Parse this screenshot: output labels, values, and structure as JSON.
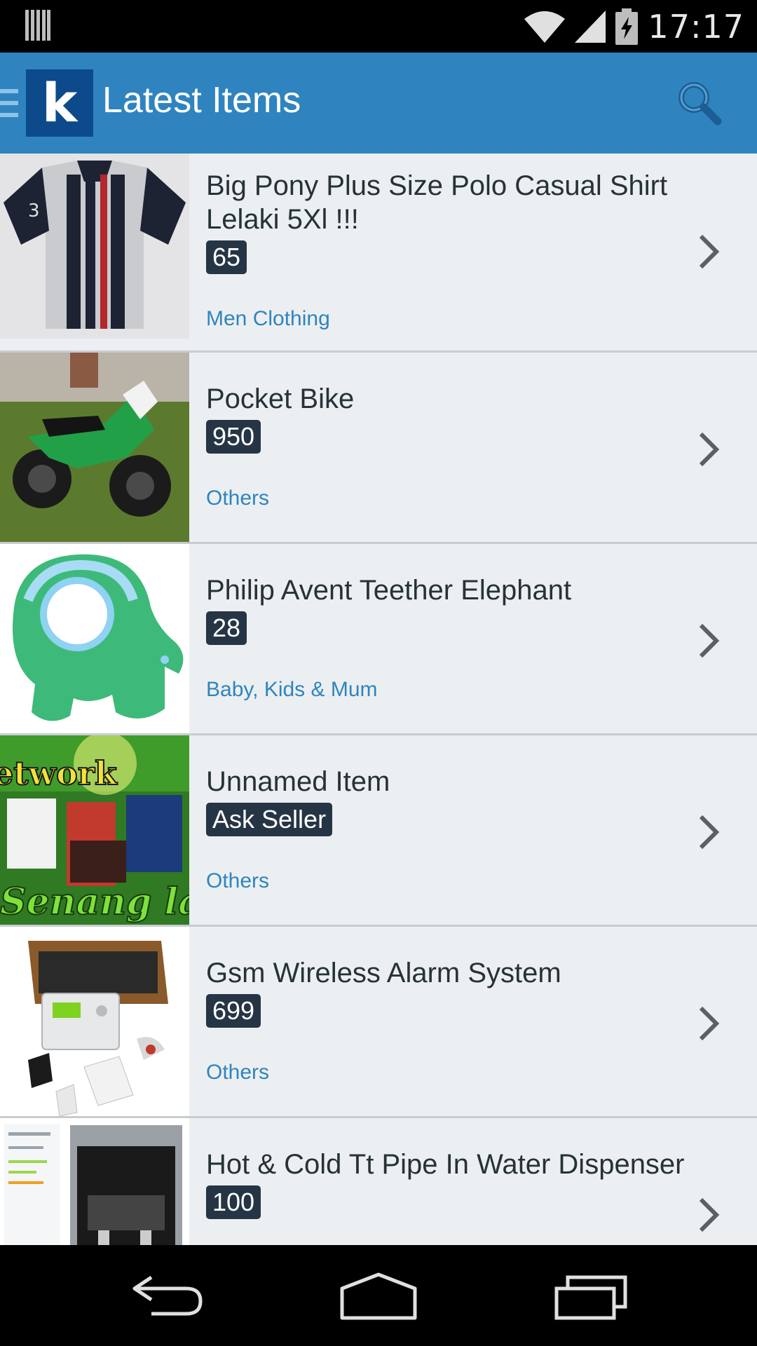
{
  "status_bar": {
    "time": "17:17",
    "icons": [
      "barcode-icon",
      "wifi-icon",
      "signal-icon",
      "battery-charging-icon"
    ]
  },
  "action_bar": {
    "logo_letter": "k",
    "title": "Latest Items",
    "icons": [
      "drawer-menu-icon",
      "search-icon"
    ]
  },
  "items": [
    {
      "title": "Big Pony Plus Size Polo Casual Shirt Lelaki 5Xl !!!",
      "price": "65",
      "category": "Men Clothing",
      "image": "polo-shirt-photo"
    },
    {
      "title": "Pocket Bike",
      "price": "950",
      "category": "Others",
      "image": "pocket-bike-photo"
    },
    {
      "title": "Philip Avent Teether Elephant",
      "price": "28",
      "category": "Baby, Kids & Mum",
      "image": "teether-elephant-photo"
    },
    {
      "title": "Unnamed Item",
      "price": "Ask Seller",
      "category": "Others",
      "image": "network-banner-photo",
      "image_text_top": "etwork",
      "image_text_bottom": "Senang lagi"
    },
    {
      "title": "Gsm Wireless Alarm System",
      "price": "699",
      "category": "Others",
      "image": "alarm-system-photo"
    },
    {
      "title": "Hot & Cold Tt Pipe In Water Dispenser",
      "price": "100",
      "category": "",
      "image": "water-dispenser-photo"
    }
  ],
  "nav_bar": {
    "icons": [
      "back-icon",
      "home-icon",
      "recent-apps-icon"
    ]
  },
  "colors": {
    "action_bar": "#2f84bf",
    "logo_bg": "#0d4a8c",
    "badge_bg": "#263545",
    "category_text": "#2f84bf",
    "list_bg": "#eceff1"
  }
}
